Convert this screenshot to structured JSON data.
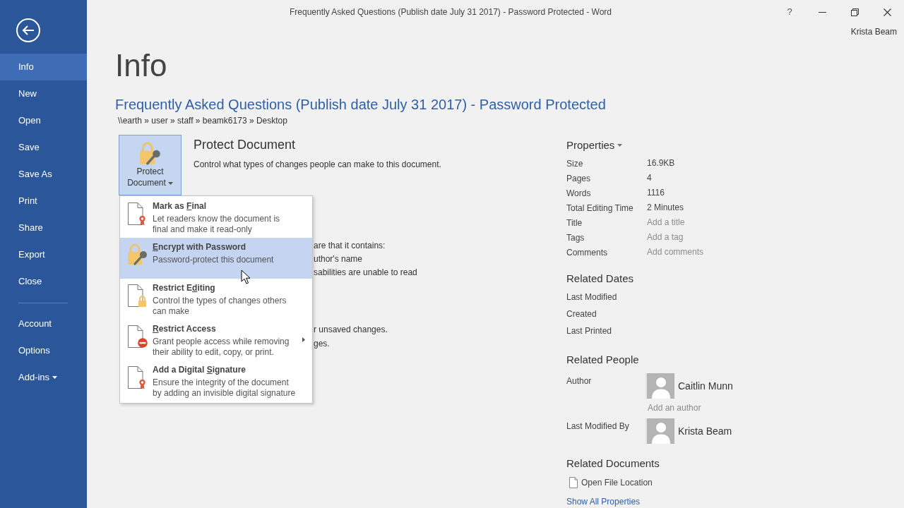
{
  "window": {
    "title": "Frequently Asked Questions (Publish date July 31 2017) - Password Protected - Word",
    "help": "?",
    "user": "Krista Beam"
  },
  "sidebar": {
    "items": [
      {
        "label": "Info",
        "selected": true
      },
      {
        "label": "New",
        "selected": false
      },
      {
        "label": "Open",
        "selected": false
      },
      {
        "label": "Save",
        "selected": false
      },
      {
        "label": "Save As",
        "selected": false
      },
      {
        "label": "Print",
        "selected": false
      },
      {
        "label": "Share",
        "selected": false
      },
      {
        "label": "Export",
        "selected": false
      },
      {
        "label": "Close",
        "selected": false
      }
    ],
    "lower_items": [
      {
        "label": "Account",
        "selected": false,
        "has_menu": false
      },
      {
        "label": "Options",
        "selected": false,
        "has_menu": false
      },
      {
        "label": "Add-ins",
        "selected": false,
        "has_menu": true
      }
    ]
  },
  "page": {
    "heading": "Info",
    "document_title": "Frequently Asked Questions (Publish date July 31 2017) - Password Protected",
    "path": "\\\\earth » user » staff » beamk6173 » Desktop"
  },
  "protect": {
    "button_label": "Protect Document",
    "heading": "Protect Document",
    "description": "Control what types of changes people can make to this document.",
    "menu": {
      "items": [
        {
          "title": [
            {
              "text": "Mark as ",
              "underline": false
            },
            {
              "text": "F",
              "underline": true
            },
            {
              "text": "inal",
              "underline": false
            }
          ],
          "description": [
            "Let readers know the document is",
            "final and make it read-only"
          ],
          "selected": false,
          "has_submenu": false
        },
        {
          "title": [
            {
              "text": "E",
              "underline": true
            },
            {
              "text": "ncrypt with Password",
              "underline": false
            }
          ],
          "description": [
            "Password-protect this document"
          ],
          "selected": true,
          "has_submenu": false
        },
        {
          "title": [
            {
              "text": "Restrict E",
              "underline": false
            },
            {
              "text": "d",
              "underline": true
            },
            {
              "text": "iting",
              "underline": false
            }
          ],
          "description": [
            "Control the types of changes others",
            "can make"
          ],
          "selected": false,
          "has_submenu": false
        },
        {
          "title": [
            {
              "text": "R",
              "underline": true
            },
            {
              "text": "estrict Access",
              "underline": false
            }
          ],
          "description": [
            "Grant people access while removing",
            "their ability to edit, copy, or print."
          ],
          "selected": false,
          "has_submenu": true
        },
        {
          "title": [
            {
              "text": "Add a Digital ",
              "underline": false
            },
            {
              "text": "S",
              "underline": true
            },
            {
              "text": "ignature",
              "underline": false
            }
          ],
          "description": [
            "Ensure the integrity of the document",
            "by adding an invisible digital signature"
          ],
          "selected": false,
          "has_submenu": false
        }
      ]
    }
  },
  "covered_lines_upper": [
    "are that it contains:",
    "uthor's name",
    "sabilities are unable to read"
  ],
  "covered_lines_lower": [
    "r unsaved changes.",
    "ges."
  ],
  "properties": {
    "heading": "Properties",
    "rows": [
      {
        "kind": "text",
        "label": "Size",
        "value": "16.9KB"
      },
      {
        "kind": "text",
        "label": "Pages",
        "value": "4"
      },
      {
        "kind": "text",
        "label": "Words",
        "value": "1116"
      },
      {
        "kind": "text",
        "label": "Total Editing Time",
        "value": "2 Minutes"
      },
      {
        "kind": "field",
        "label": "Title",
        "placeholder": "Add a title"
      },
      {
        "kind": "field",
        "label": "Tags",
        "placeholder": "Add a tag"
      },
      {
        "kind": "field",
        "label": "Comments",
        "placeholder": "Add comments"
      }
    ]
  },
  "related_dates": {
    "heading": "Related Dates",
    "rows": [
      {
        "label": "Last Modified"
      },
      {
        "label": "Created"
      },
      {
        "label": "Last Printed"
      }
    ]
  },
  "related_people": {
    "heading": "Related People",
    "rows": [
      {
        "label": "Author",
        "people": [
          {
            "name": "Caitlin Munn"
          }
        ],
        "placeholder": "Add an author"
      },
      {
        "label": "Last Modified By",
        "people": [
          {
            "name": "Krista Beam"
          }
        ]
      }
    ]
  },
  "related_documents": {
    "heading": "Related Documents",
    "items": [
      {
        "label": "Open File Location"
      }
    ],
    "link": "Show All Properties"
  }
}
